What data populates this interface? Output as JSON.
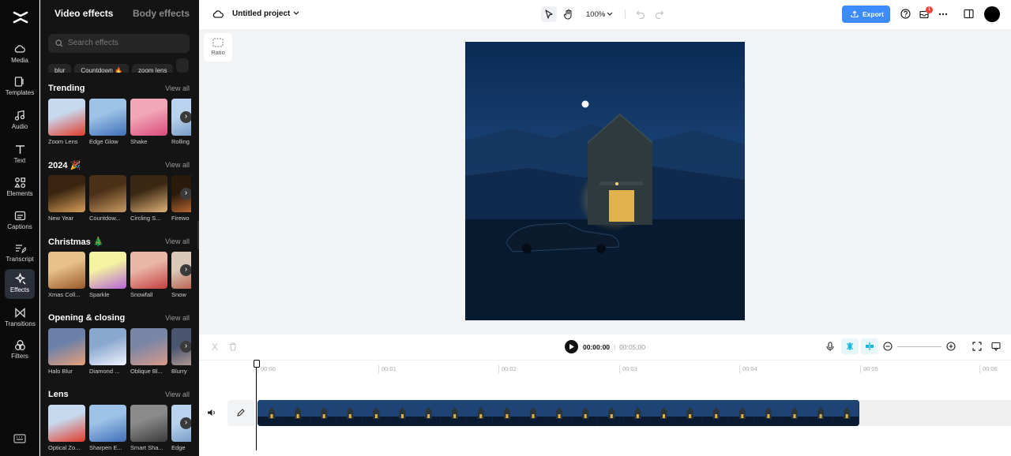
{
  "nav": {
    "items": [
      {
        "label": "Media",
        "icon": "media-icon"
      },
      {
        "label": "Templates",
        "icon": "templates-icon"
      },
      {
        "label": "Audio",
        "icon": "audio-icon"
      },
      {
        "label": "Text",
        "icon": "text-icon"
      },
      {
        "label": "Elements",
        "icon": "elements-icon"
      },
      {
        "label": "Captions",
        "icon": "captions-icon"
      },
      {
        "label": "Transcript",
        "icon": "transcript-icon"
      },
      {
        "label": "Effects",
        "icon": "effects-icon",
        "active": true
      },
      {
        "label": "Transitions",
        "icon": "transitions-icon"
      },
      {
        "label": "Filters",
        "icon": "filters-icon"
      }
    ]
  },
  "panel": {
    "tabs": [
      "Video effects",
      "Body effects"
    ],
    "search_placeholder": "Search effects",
    "chips": [
      "blur",
      "Countdown 🔥",
      "zoom lens"
    ],
    "view_all": "View all",
    "sections": [
      {
        "title": "Trending",
        "items": [
          "Zoom Lens",
          "Edge Glow",
          "Shake",
          "Rolling"
        ]
      },
      {
        "title": "2024 🎉",
        "items": [
          "New Year",
          "Countdow...",
          "Circling S...",
          "Firewo"
        ]
      },
      {
        "title": "Christmas 🎄",
        "items": [
          "Xmas Coll...",
          "Sparkle",
          "Snowfall",
          "Snow"
        ]
      },
      {
        "title": "Opening & closing",
        "items": [
          "Halo Blur",
          "Diamond ...",
          "Oblique Bl...",
          "Blurry"
        ]
      },
      {
        "title": "Lens",
        "items": [
          "Optical Zo...",
          "Sharpen E...",
          "Smart Sha...",
          "Edge"
        ]
      }
    ]
  },
  "topbar": {
    "project_name": "Untitled project",
    "zoom": "100%",
    "export_label": "Export",
    "notification_count": "1"
  },
  "canvas": {
    "ratio_label": "Ratio"
  },
  "timeline": {
    "current_time": "00:00:00",
    "separator": "|",
    "total_time": "00:05:00",
    "ruler": [
      "00:00",
      "00:01",
      "00:02",
      "00:03",
      "00:04",
      "00:05",
      "00:06"
    ]
  },
  "colors": {
    "accent": "#3c8cff",
    "nav_bg": "#0b0b0b",
    "panel_bg": "#141414",
    "clip": "#1a3559"
  }
}
